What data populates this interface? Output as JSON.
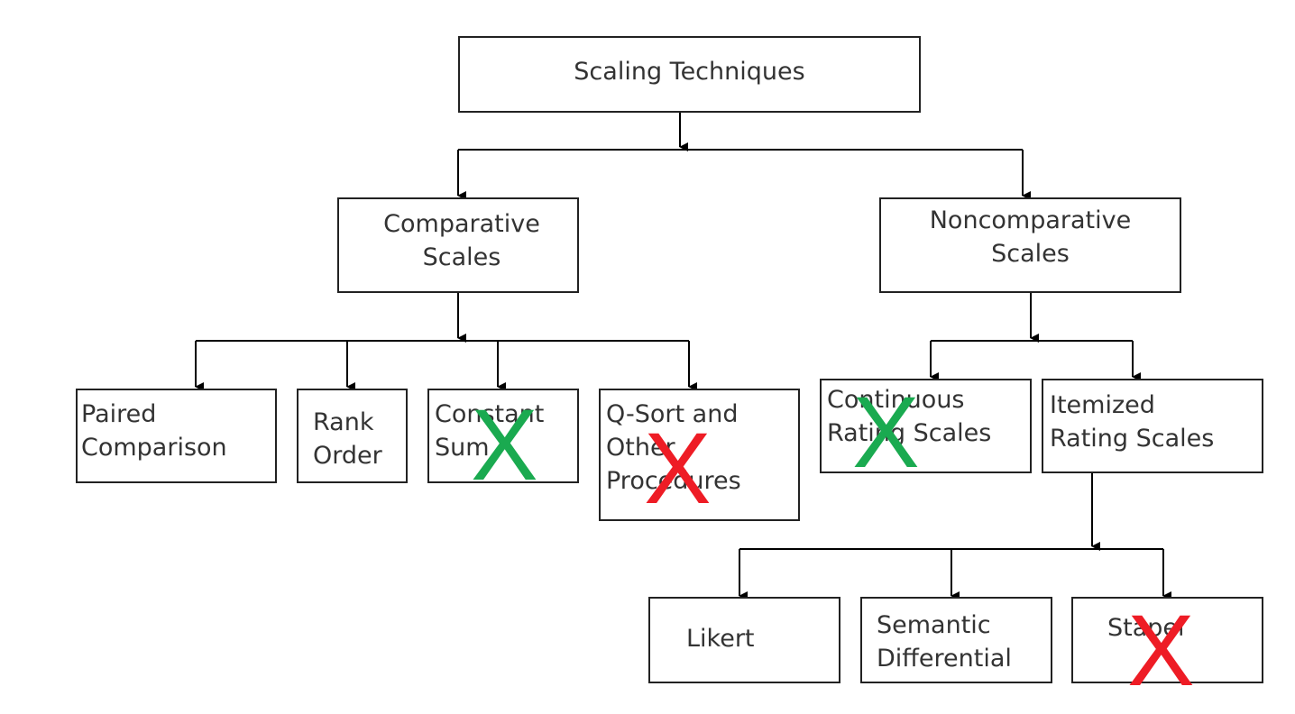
{
  "title": "Scaling Techniques",
  "nodes": {
    "root": "Scaling Techniques",
    "comparative": [
      "Comparative",
      "Scales"
    ],
    "noncomparative": [
      "Noncomparative",
      "Scales"
    ],
    "paired": [
      "Paired",
      "Comparison"
    ],
    "rank": [
      "Rank",
      "Order"
    ],
    "constant": [
      "Constant",
      "Sum"
    ],
    "qsort": [
      "Q-Sort and",
      "Other",
      "Procedures"
    ],
    "continuous": [
      "Continuous",
      "Rating Scales"
    ],
    "itemized": [
      "Itemized",
      "Rating Scales"
    ],
    "likert": "Likert",
    "semantic": [
      "Semantic",
      "Differential"
    ],
    "stapel": "Stapel"
  },
  "marks": {
    "constant": {
      "symbol": "X",
      "color": "#1aaa50"
    },
    "qsort": {
      "symbol": "X",
      "color": "#ee1c25"
    },
    "continuous": {
      "symbol": "X",
      "color": "#1aaa50"
    },
    "stapel": {
      "symbol": "X",
      "color": "#ee1c25"
    }
  }
}
